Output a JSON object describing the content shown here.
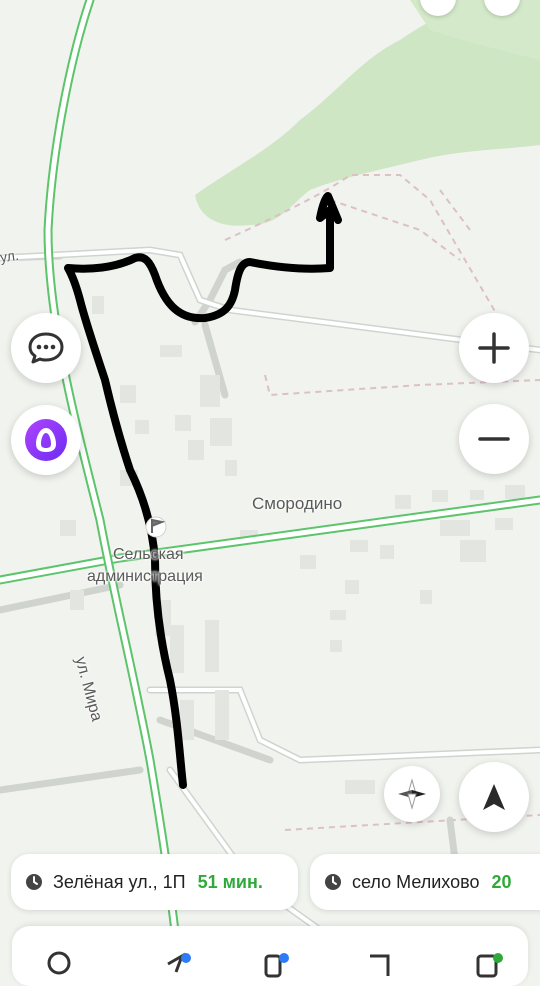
{
  "map": {
    "place_label": "Смородино",
    "poi_label_line1": "Сельская",
    "poi_label_line2": "администрация",
    "street_label": "ул. Мира",
    "partial_street_label": "ул.",
    "colors": {
      "background": "#f1f3ee",
      "forest": "#cfe6c4",
      "main_road_outline": "#5cc46a",
      "route_drawing": "#000000"
    }
  },
  "controls": {
    "chat_button_icon": "chat-bubble-icon",
    "assistant_button_icon": "alice-assistant-icon",
    "zoom_in_icon": "plus-icon",
    "zoom_out_icon": "minus-icon",
    "compass_icon": "compass-icon",
    "locate_icon": "navigation-arrow-icon"
  },
  "destinations": [
    {
      "name": "Зелёная ул., 1П",
      "eta": "51 мин.",
      "icon": "clock-icon"
    },
    {
      "name": "село Мелихово",
      "eta": "20",
      "icon": "clock-icon"
    }
  ],
  "tabbar": {
    "icons": [
      "search-icon",
      "navigator-icon",
      "transport-icon",
      "bookmark-icon",
      "menu-icon"
    ]
  }
}
